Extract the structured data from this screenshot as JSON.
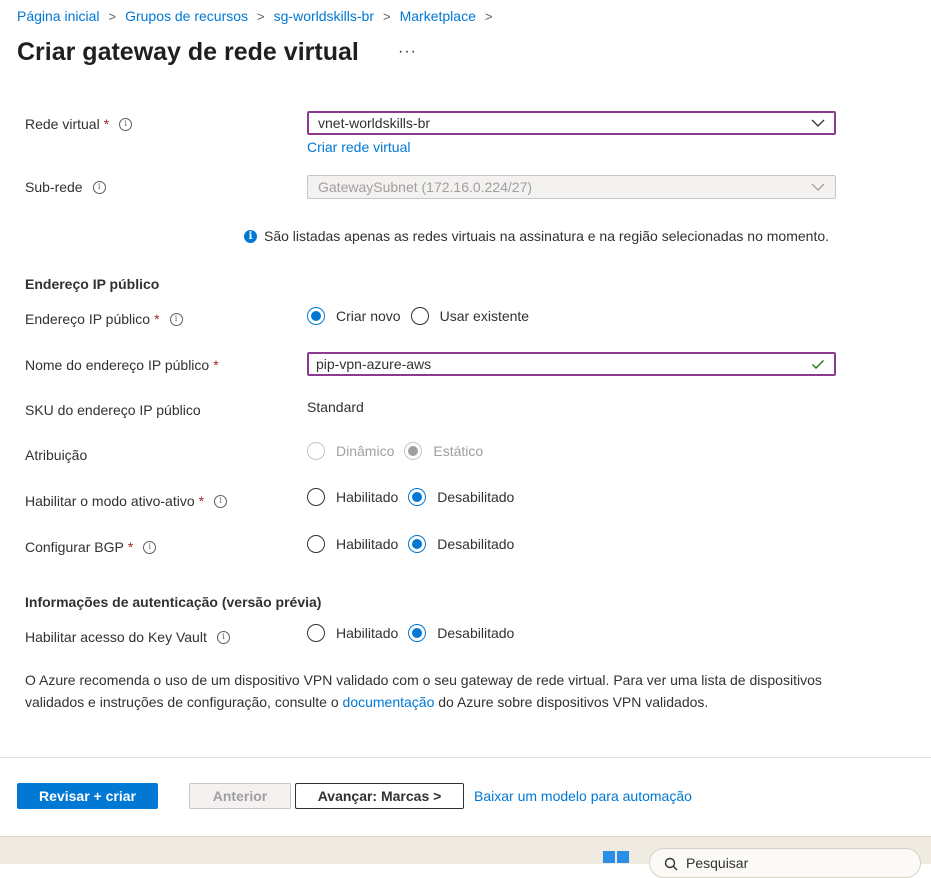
{
  "breadcrumb": [
    "Página inicial",
    "Grupos de recursos",
    "sg-worldskills-br",
    "Marketplace"
  ],
  "page_title": "Criar gateway de rede virtual",
  "more_label": "···",
  "form": {
    "rede_virtual": {
      "label": "Rede virtual",
      "value": "vnet-worldskills-br",
      "create_link": "Criar rede virtual"
    },
    "sub_rede": {
      "label": "Sub-rede",
      "value": "GatewaySubnet (172.16.0.224/27)"
    },
    "info_note": "São listadas apenas as redes virtuais na assinatura e na região selecionadas no momento.",
    "section_ip": "Endereço IP público",
    "ip_publico": {
      "label": "Endereço IP público",
      "opt1": "Criar novo",
      "opt2": "Usar existente",
      "selected": "Criar novo"
    },
    "ip_nome": {
      "label": "Nome do endereço IP público",
      "value": "pip-vpn-azure-aws"
    },
    "sku": {
      "label": "SKU do endereço IP público",
      "value": "Standard"
    },
    "atribuicao": {
      "label": "Atribuição",
      "opt1": "Dinâmico",
      "opt2": "Estático",
      "selected": "Estático"
    },
    "ativo_ativo": {
      "label": "Habilitar o modo ativo-ativo",
      "opt1": "Habilitado",
      "opt2": "Desabilitado",
      "selected": "Desabilitado"
    },
    "bgp": {
      "label": "Configurar BGP",
      "opt1": "Habilitado",
      "opt2": "Desabilitado",
      "selected": "Desabilitado"
    },
    "section_auth": "Informações de autenticação (versão prévia)",
    "key_vault": {
      "label": "Habilitar acesso do Key Vault",
      "opt1": "Habilitado",
      "opt2": "Desabilitado",
      "selected": "Desabilitado"
    },
    "recommend": {
      "before": "O Azure recomenda o uso de um dispositivo VPN validado com o seu gateway de rede virtual. Para ver uma lista de dispositivos validados e instruções de configuração, consulte o ",
      "link": "documentação",
      "after": " do Azure sobre dispositivos VPN validados."
    }
  },
  "footer": {
    "review_create": "Revisar + criar",
    "previous": "Anterior",
    "next": "Avançar: Marcas >",
    "download": "Baixar um modelo para automação"
  },
  "taskbar": {
    "search_text": "Pesquisar"
  },
  "colors": {
    "accent": "#0078d4",
    "required": "#a4262c",
    "valid": "#107c10",
    "focus_border": "#8b3b8f"
  }
}
